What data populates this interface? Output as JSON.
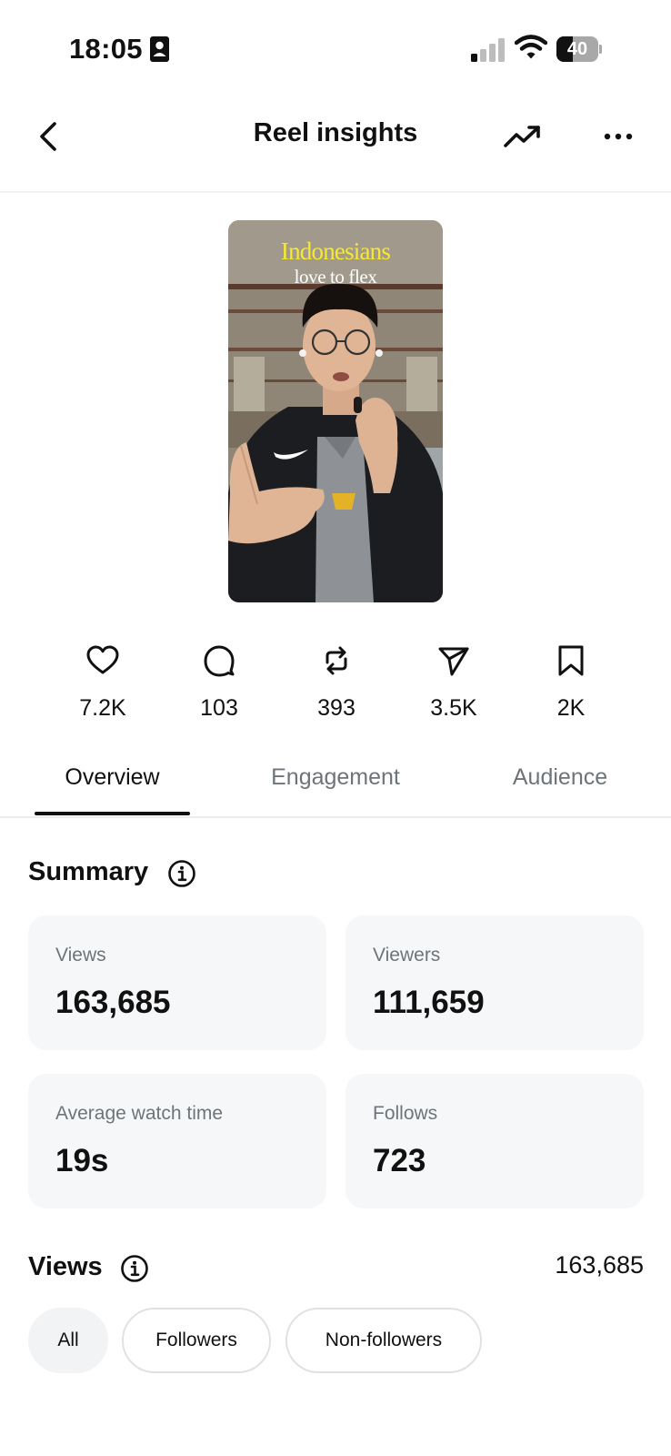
{
  "status_bar": {
    "time": "18:05",
    "battery_level": "40",
    "battery_fraction": 0.4,
    "signal_bars_active": 1,
    "signal_bars_total": 4
  },
  "header": {
    "title": "Reel insights",
    "back_icon": "chevron-left-icon",
    "trend_icon": "trending-up-icon",
    "more_icon": "more-horizontal-icon"
  },
  "reel": {
    "caption_line_1": "Indonesians",
    "caption_line_2": "love to flex"
  },
  "stats": [
    {
      "icon": "heart-icon",
      "value": "7.2K"
    },
    {
      "icon": "comment-icon",
      "value": "103"
    },
    {
      "icon": "repost-icon",
      "value": "393"
    },
    {
      "icon": "share-icon",
      "value": "3.5K"
    },
    {
      "icon": "bookmark-icon",
      "value": "2K"
    }
  ],
  "tabs": [
    {
      "label": "Overview",
      "active": true
    },
    {
      "label": "Engagement",
      "active": false
    },
    {
      "label": "Audience",
      "active": false
    }
  ],
  "summary": {
    "title": "Summary",
    "cards": [
      {
        "label": "Views",
        "value": "163,685"
      },
      {
        "label": "Viewers",
        "value": "111,659"
      },
      {
        "label": "Average watch time",
        "value": "19s"
      },
      {
        "label": "Follows",
        "value": "723"
      }
    ]
  },
  "views": {
    "title": "Views",
    "total": "163,685",
    "filters": [
      {
        "label": "All",
        "selected": true
      },
      {
        "label": "Followers",
        "selected": false
      },
      {
        "label": "Non-followers",
        "selected": false
      }
    ]
  },
  "colors": {
    "text_primary": "#111111",
    "text_secondary": "#6e7479",
    "card_background": "#f6f7f8",
    "caption_yellow": "#f7e830"
  }
}
